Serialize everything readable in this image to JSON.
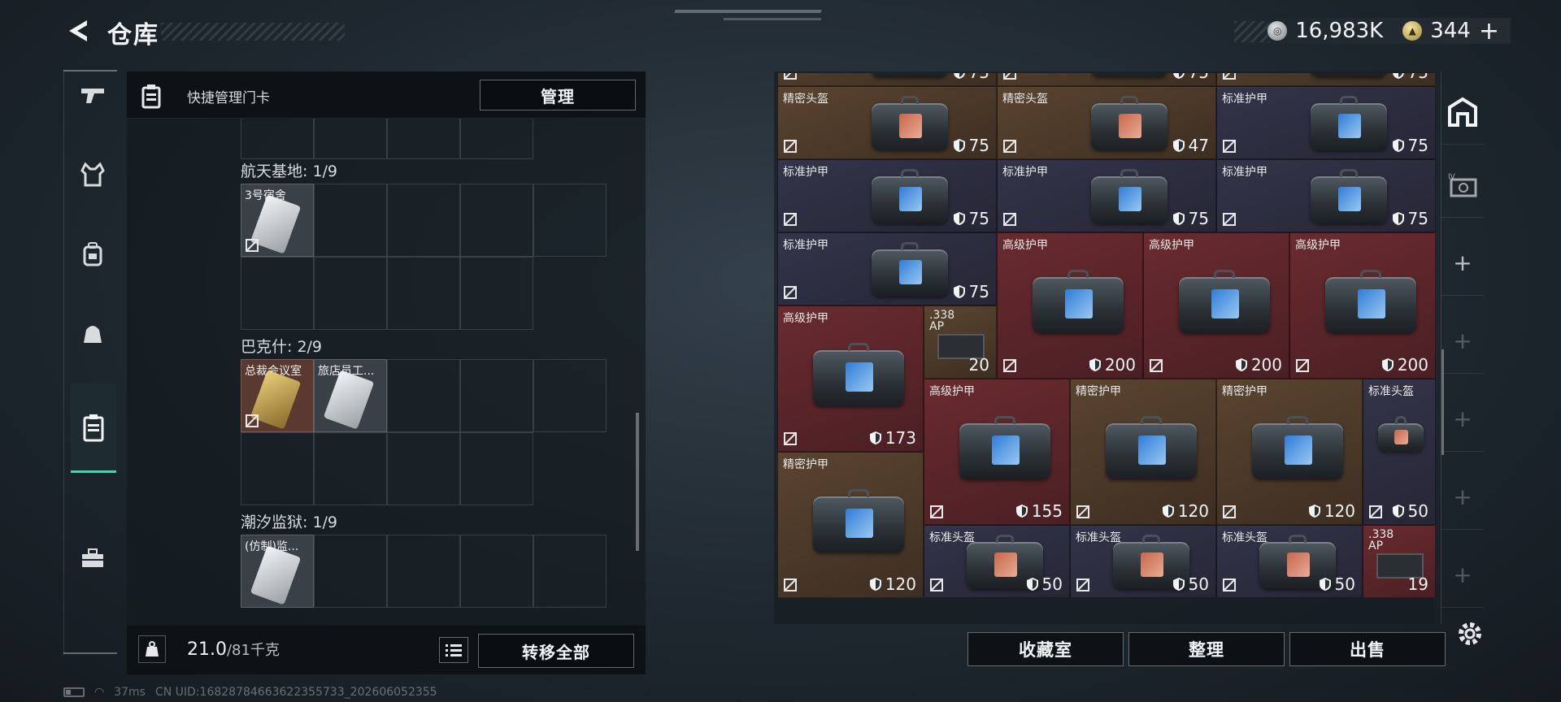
{
  "header": {
    "title": "仓库"
  },
  "currency": {
    "silver_value": "16,983K",
    "gold_value": "344",
    "gold_plus": "+"
  },
  "left_panel": {
    "header_label": "快捷管理门卡",
    "manage_label": "管理",
    "groups": [
      {
        "label": "航天基地: 1/9",
        "cards": [
          {
            "name": "3号宿舍",
            "color": "#d6d8da"
          }
        ]
      },
      {
        "label": "巴克什: 2/9",
        "cards": [
          {
            "name": "总裁会议室",
            "color": "#c9a54a"
          },
          {
            "name": "旅店员工...",
            "color": "#d6d8da"
          }
        ]
      },
      {
        "label": "潮汐监狱: 1/9",
        "cards": [
          {
            "name": "(仿制)监...",
            "color": "#d6d8da"
          }
        ]
      }
    ],
    "weight_value": "21.0",
    "weight_total": "/81千克",
    "transfer_label": "转移全部"
  },
  "stash": {
    "items": [
      {
        "name": "",
        "value": "75",
        "bg": "brown"
      },
      {
        "name": "",
        "value": "75",
        "bg": "brown"
      },
      {
        "name": "",
        "value": "75",
        "bg": "brown"
      },
      {
        "name": "精密头盔",
        "value": "75",
        "bg": "brown"
      },
      {
        "name": "精密头盔",
        "value": "47",
        "bg": "brown"
      },
      {
        "name": "标准护甲",
        "value": "75",
        "bg": "navy"
      },
      {
        "name": "标准护甲",
        "value": "75",
        "bg": "navy"
      },
      {
        "name": "标准护甲",
        "value": "75",
        "bg": "navy"
      },
      {
        "name": "标准护甲",
        "value": "75",
        "bg": "navy"
      },
      {
        "name": "标准护甲",
        "value": "75",
        "bg": "navy"
      },
      {
        "name": "高级护甲",
        "value": "200",
        "bg": "red"
      },
      {
        "name": "高级护甲",
        "value": "200",
        "bg": "red"
      },
      {
        "name": "高级护甲",
        "value": "200",
        "bg": "red"
      },
      {
        "name": "高级护甲",
        "value": "173",
        "bg": "red"
      },
      {
        "name": ".338 AP",
        "value": "20",
        "bg": "brown"
      },
      {
        "name": "高级护甲",
        "value": "155",
        "bg": "red"
      },
      {
        "name": "精密护甲",
        "value": "120",
        "bg": "brown"
      },
      {
        "name": "精密护甲",
        "value": "120",
        "bg": "brown"
      },
      {
        "name": "标准头盔",
        "value": "50",
        "bg": "navy"
      },
      {
        "name": "精密护甲",
        "value": "120",
        "bg": "brown"
      },
      {
        "name": "标准头盔",
        "value": "50",
        "bg": "navy"
      },
      {
        "name": "标准头盔",
        "value": "50",
        "bg": "navy"
      },
      {
        "name": "标准头盔",
        "value": "50",
        "bg": "navy"
      },
      {
        "name": ".338 AP",
        "value": "19",
        "bg": "red"
      }
    ]
  },
  "bottom": {
    "collection_label": "收藏室",
    "sort_label": "整理",
    "sell_label": "出售"
  },
  "status": {
    "ping": "37ms",
    "uid": "CN UID:16828784663622355733_202606052355"
  }
}
